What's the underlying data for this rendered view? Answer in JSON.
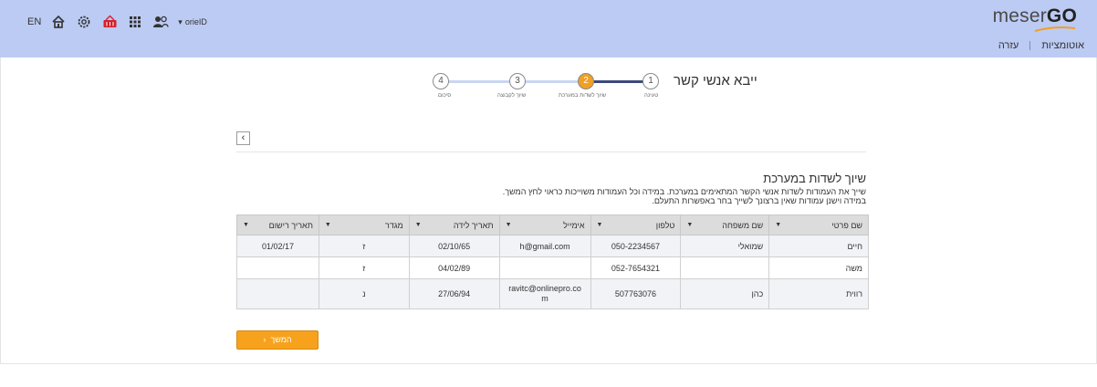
{
  "header": {
    "lang": "EN",
    "username": "orieID",
    "brand_light": "meser",
    "brand_bold": "GO",
    "nav": [
      "אוטומציות",
      "עזרה"
    ],
    "icons": [
      "home-icon",
      "gear-icon",
      "basket-icon",
      "apps-grid-icon",
      "users-icon",
      "caret-down-icon"
    ]
  },
  "page": {
    "title": "ייבא אנשי קשר"
  },
  "steps": [
    {
      "num": "1",
      "label": "טעינה"
    },
    {
      "num": "2",
      "label": "שיוך לשדות במערכת"
    },
    {
      "num": "3",
      "label": "שיוך לקבוצה"
    },
    {
      "num": "4",
      "label": "סיכום"
    }
  ],
  "active_step": 2,
  "section": {
    "title": "שיוך לשדות במערכת",
    "desc_line1": "שייך את העמודות לשדות אנשי הקשר המתאימים במערכת. במידה וכל העמודות משוייכות כראוי לחץ המשך.",
    "desc_line2": "במידה וישנן עמודות שאין ברצונך לשייך בחר באפשרות התעלם."
  },
  "table": {
    "headers": [
      "שם פרטי",
      "שם משפחה",
      "טלפון",
      "אימייל",
      "תאריך לידה",
      "מגדר",
      "תאריך רישום"
    ],
    "rows": [
      [
        "חיים",
        "שמואלי",
        "050-2234567",
        "h@gmail.com",
        "02/10/65",
        "ז",
        "01/02/17"
      ],
      [
        "משה",
        "",
        "052-7654321",
        "",
        "04/02/89",
        "ז",
        ""
      ],
      [
        "רווית",
        "כהן",
        "507763076",
        "ravitc@onlinepro.co\nm",
        "27/06/94",
        "נ",
        ""
      ]
    ]
  },
  "continue_label": "המשך",
  "colors": {
    "header_bg": "#bccbf3",
    "accent": "#f6a21d",
    "progress_done": "#3b4a7a",
    "progress_todo": "#c9d6f1"
  }
}
